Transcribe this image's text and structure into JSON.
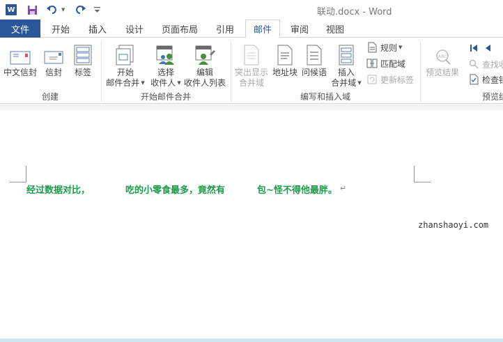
{
  "title_bar": {
    "title": "联动.docx - Word",
    "app_icon": "word-logo-icon",
    "app_icon_letter": "W"
  },
  "tabs": [
    {
      "label": "文件"
    },
    {
      "label": "开始"
    },
    {
      "label": "插入"
    },
    {
      "label": "设计"
    },
    {
      "label": "页面布局"
    },
    {
      "label": "引用"
    },
    {
      "label": "邮件"
    },
    {
      "label": "审阅"
    },
    {
      "label": "视图"
    }
  ],
  "ribbon": {
    "create": {
      "label": "创建",
      "chinese_envelope": "中文信封",
      "envelope": "信封",
      "labels": "标签"
    },
    "start_merge": {
      "label": "开始邮件合并",
      "start_line1": "开始",
      "start_line2": "邮件合并",
      "select_line1": "选择",
      "select_line2": "收件人",
      "edit_line1": "编辑",
      "edit_line2": "收件人列表"
    },
    "write_insert": {
      "label": "编写和插入域",
      "highlight_line1": "突出显示",
      "highlight_line2": "合并域",
      "address_block": "地址块",
      "greeting_line": "问候语",
      "insert_line1": "插入",
      "insert_line2": "合并域",
      "rules": "规则",
      "match_fields": "匹配域",
      "update_labels": "更新标签"
    },
    "preview": {
      "label": "预览结",
      "preview_results": "预览结果",
      "find": "查找收",
      "check": "检查错"
    }
  },
  "document": {
    "text_1": "经过数据对比，",
    "text_2": "吃的小零食最多，竟然有",
    "text_3": "包~怪不得他最胖。",
    "paragraph_mark": "↵"
  },
  "watermark": "zhanshaoyi.com",
  "colors": {
    "brand_blue": "#2b579a",
    "doc_text_green": "#1b9a4a"
  }
}
